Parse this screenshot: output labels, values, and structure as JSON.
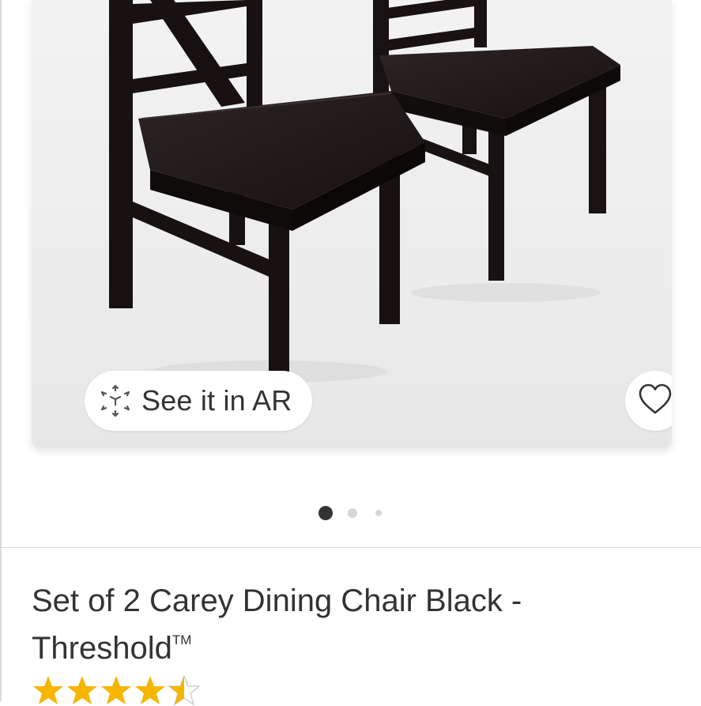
{
  "product": {
    "ar_button_label": "See it in AR",
    "title": "Set of 2 Carey Dining Chair Black - Threshold",
    "title_trademark": "TM",
    "rating": 4.5
  },
  "gallery": {
    "image_count": 3,
    "active_index": 1
  },
  "icons": {
    "ar": "ar-cube-icon",
    "favorite": "heart-outline-icon",
    "star": "star-icon"
  },
  "colors": {
    "text": "#333333",
    "star": "#f5b600",
    "dot_active": "#333333",
    "dot_inactive": "#d6d6d6"
  }
}
